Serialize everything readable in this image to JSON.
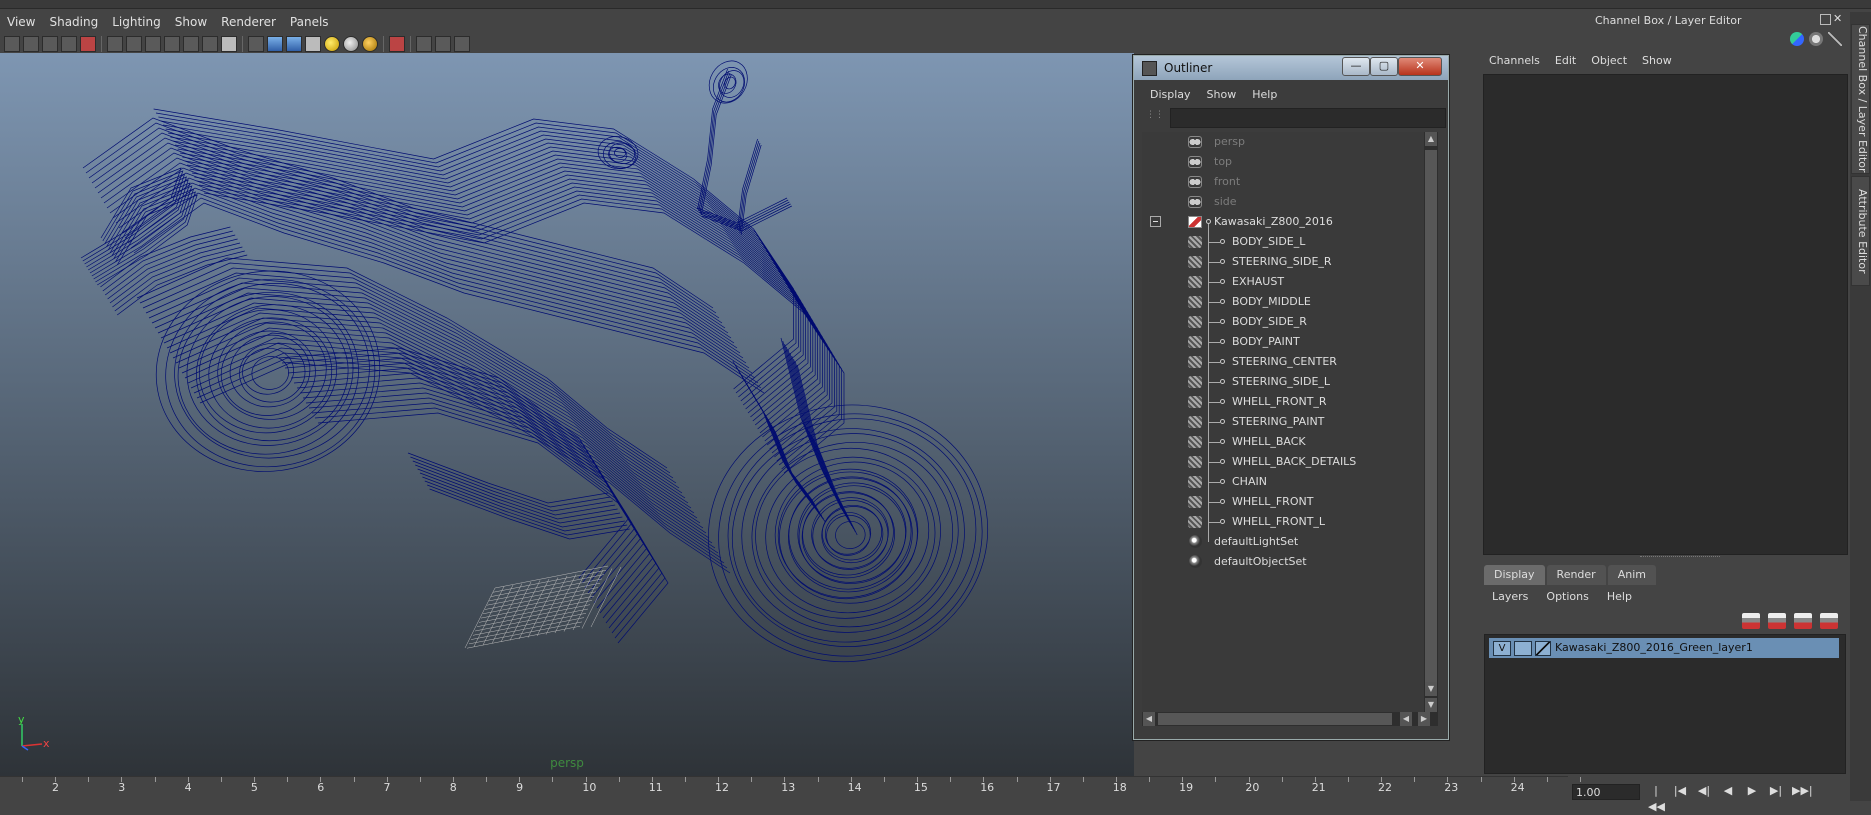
{
  "menubar": {
    "items": [
      "View",
      "Shading",
      "Lighting",
      "Show",
      "Renderer",
      "Panels"
    ]
  },
  "viewport": {
    "camera_label": "persp",
    "axis_y": "y",
    "axis_x": "x",
    "wire_color": "#000c70"
  },
  "outliner": {
    "title": "Outliner",
    "buttons": {
      "minimize": "—",
      "maximize": "▢",
      "close": "✕"
    },
    "menu": [
      "Display",
      "Show",
      "Help"
    ],
    "search_value": "",
    "cameras": [
      "persp",
      "top",
      "front",
      "side"
    ],
    "group": "Kawasaki_Z800_2016",
    "children": [
      "BODY_SIDE_L",
      "STEERING_SIDE_R",
      "EXHAUST",
      "BODY_MIDDLE",
      "BODY_SIDE_R",
      "BODY_PAINT",
      "STEERING_CENTER",
      "STEERING_SIDE_L",
      "WHELL_FRONT_R",
      "STEERING_PAINT",
      "WHELL_BACK",
      "WHELL_BACK_DETAILS",
      "CHAIN",
      "WHELL_FRONT",
      "WHELL_FRONT_L"
    ],
    "sets": [
      "defaultLightSet",
      "defaultObjectSet"
    ]
  },
  "channel_box": {
    "title": "Channel Box / Layer Editor",
    "menu": [
      "Channels",
      "Edit",
      "Object",
      "Show"
    ]
  },
  "side_tabs": [
    "Channel Box / Layer Editor",
    "Attribute Editor"
  ],
  "layer_editor": {
    "tabs": [
      "Display",
      "Render",
      "Anim"
    ],
    "active_tab": "Display",
    "menu": [
      "Layers",
      "Options",
      "Help"
    ],
    "layer": {
      "visible": "V",
      "name": "Kawasaki_Z800_2016_Green_layer1"
    }
  },
  "timeline": {
    "ticks": [
      "2",
      "3",
      "4",
      "5",
      "6",
      "7",
      "8",
      "9",
      "10",
      "11",
      "12",
      "13",
      "14",
      "15",
      "16",
      "17",
      "18",
      "19",
      "20",
      "21",
      "22",
      "23",
      "24"
    ],
    "current_time": "1.00"
  },
  "playback": [
    "|◀◀",
    "|◀",
    "◀|",
    "◀",
    "▶",
    "▶|",
    "▶▶|"
  ]
}
